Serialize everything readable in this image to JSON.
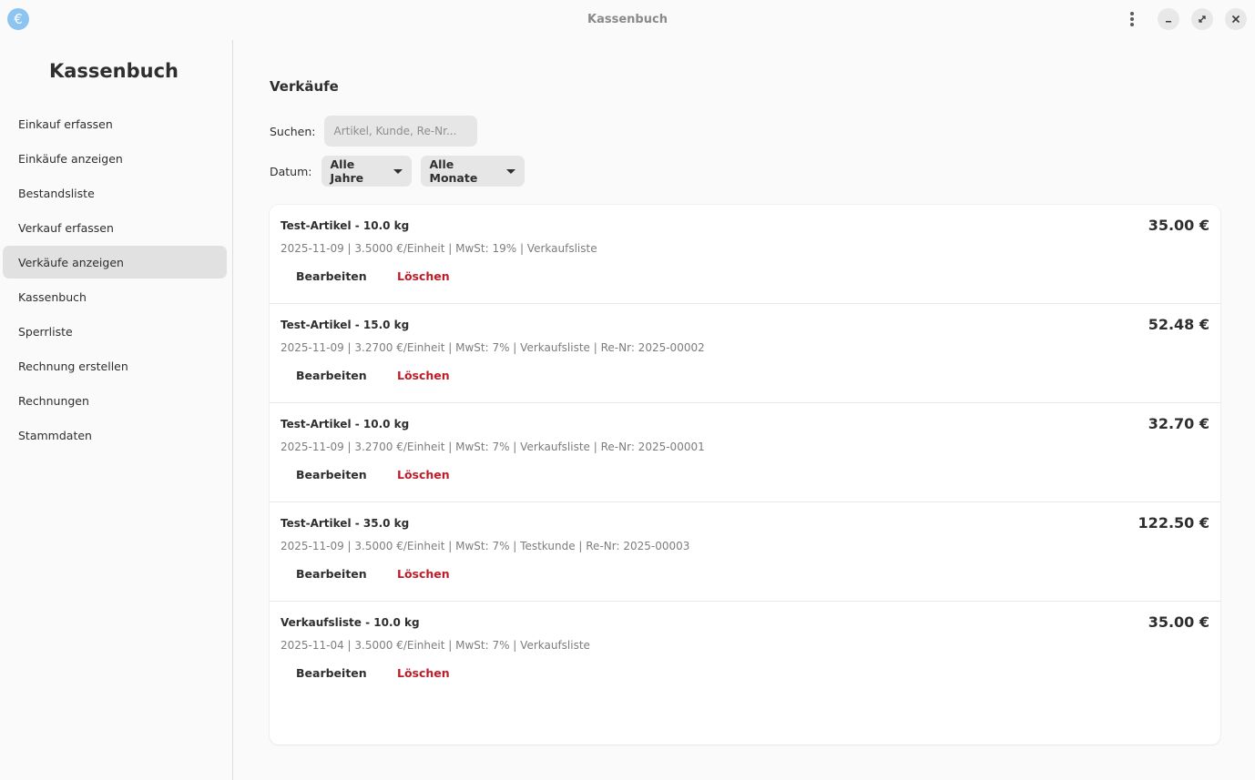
{
  "window": {
    "title": "Kassenbuch",
    "app_icon_glyph": "€"
  },
  "sidebar": {
    "title": "Kassenbuch",
    "items": [
      {
        "label": "Einkauf erfassen"
      },
      {
        "label": "Einkäufe anzeigen"
      },
      {
        "label": "Bestandsliste"
      },
      {
        "label": "Verkauf erfassen"
      },
      {
        "label": "Verkäufe anzeigen",
        "active": true
      },
      {
        "label": "Kassenbuch"
      },
      {
        "label": "Sperrliste"
      },
      {
        "label": "Rechnung erstellen"
      },
      {
        "label": "Rechnungen"
      },
      {
        "label": "Stammdaten"
      }
    ]
  },
  "main": {
    "title": "Verkäufe",
    "search": {
      "label": "Suchen:",
      "placeholder": "Artikel, Kunde, Re-Nr...",
      "value": ""
    },
    "date_filter": {
      "label": "Datum:",
      "year": "Alle Jahre",
      "month": "Alle Monate"
    },
    "sales": [
      {
        "title": "Test-Artikel - 10.0 kg",
        "meta": "2025-11-09 | 3.5000 €/Einheit | MwSt: 19% | Verkaufsliste",
        "amount": "35.00 €",
        "edit_label": "Bearbeiten",
        "delete_label": "Löschen"
      },
      {
        "title": "Test-Artikel - 15.0 kg",
        "meta": "2025-11-09 | 3.2700 €/Einheit | MwSt: 7% | Verkaufsliste | Re-Nr: 2025-00002",
        "amount": "52.48 €",
        "edit_label": "Bearbeiten",
        "delete_label": "Löschen"
      },
      {
        "title": "Test-Artikel - 10.0 kg",
        "meta": "2025-11-09 | 3.2700 €/Einheit | MwSt: 7% | Verkaufsliste | Re-Nr: 2025-00001",
        "amount": "32.70 €",
        "edit_label": "Bearbeiten",
        "delete_label": "Löschen"
      },
      {
        "title": "Test-Artikel - 35.0 kg",
        "meta": "2025-11-09 | 3.5000 €/Einheit | MwSt: 7% | Testkunde | Re-Nr: 2025-00003",
        "amount": "122.50 €",
        "edit_label": "Bearbeiten",
        "delete_label": "Löschen"
      },
      {
        "title": "Verkaufsliste - 10.0 kg",
        "meta": "2025-11-04 | 3.5000 €/Einheit | MwSt: 7% | Verkaufsliste",
        "amount": "35.00 €",
        "edit_label": "Bearbeiten",
        "delete_label": "Löschen"
      }
    ]
  },
  "colors": {
    "accent_icon": "#8ec5f0",
    "delete_red": "#c01c28",
    "active_nav_bg": "#e1e1e1"
  },
  "icons": {
    "app": "euro-icon",
    "menu": "kebab-menu-icon",
    "minimize": "minimize-icon",
    "maximize": "maximize-icon",
    "close": "close-icon",
    "dropdown": "chevron-down-icon"
  }
}
